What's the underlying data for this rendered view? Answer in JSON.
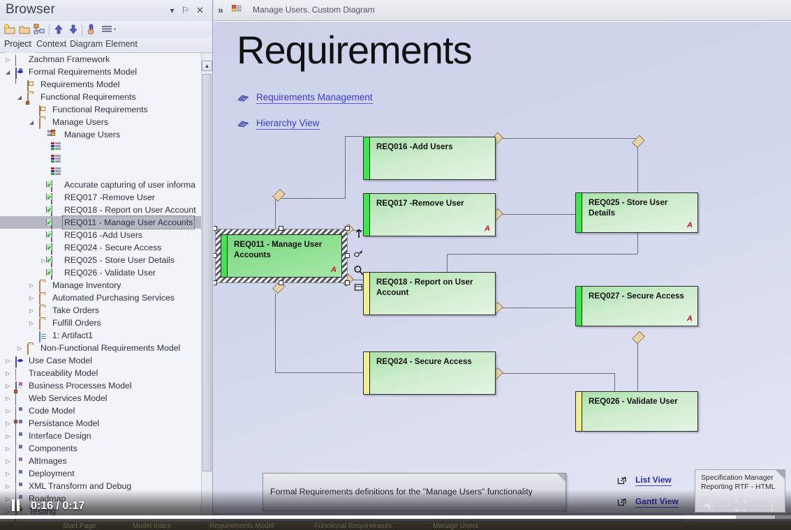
{
  "browser": {
    "title": "Browser",
    "header_buttons": [
      {
        "name": "caret-down-icon",
        "glyph": "▾"
      },
      {
        "name": "pin-icon",
        "glyph": "⚐"
      },
      {
        "name": "close-icon",
        "glyph": "✕"
      }
    ],
    "toolbar_icons": [
      "new-package-icon",
      "folder-icon",
      "hierarchy-icon",
      "move-up-icon",
      "move-down-icon",
      "pointer-hand-icon",
      "menu-icon"
    ],
    "tabs": [
      {
        "label": "Project",
        "active": true
      },
      {
        "label": "Context",
        "active": false
      },
      {
        "label": "Diagram",
        "active": false
      },
      {
        "label": "Element",
        "active": false
      }
    ],
    "tree": [
      {
        "label": "Zachman Framework",
        "indent": 0,
        "icon": "model-box",
        "arrow": "closed",
        "selected": false
      },
      {
        "label": "Formal Requirements Model",
        "indent": 0,
        "icon": "model-oval",
        "arrow": "open",
        "selected": false
      },
      {
        "label": "Requirements Model",
        "indent": 1,
        "icon": "package",
        "arrow": "none",
        "selected": false
      },
      {
        "label": "Functional Requirements",
        "indent": 1,
        "icon": "folder-sub",
        "arrow": "open",
        "selected": false
      },
      {
        "label": "Functional Requirements",
        "indent": 2,
        "icon": "package",
        "arrow": "none",
        "selected": false
      },
      {
        "label": "Manage Users",
        "indent": 2,
        "icon": "folder",
        "arrow": "open",
        "selected": false
      },
      {
        "label": "Manage Users",
        "indent": 3,
        "icon": "diagram",
        "arrow": "none",
        "selected": false
      },
      {
        "label": "",
        "indent": 3,
        "icon": "matrix",
        "arrow": "none",
        "selected": false
      },
      {
        "label": "",
        "indent": 3,
        "icon": "matrix",
        "arrow": "none",
        "selected": false
      },
      {
        "label": "",
        "indent": 3,
        "icon": "matrix",
        "arrow": "none",
        "selected": false
      },
      {
        "label": "Accurate capturing of user informa",
        "indent": 3,
        "icon": "requirement",
        "arrow": "none",
        "selected": false
      },
      {
        "label": "REQ017 -Remove User",
        "indent": 3,
        "icon": "requirement",
        "arrow": "none",
        "selected": false
      },
      {
        "label": "REQ018 - Report on User Account",
        "indent": 3,
        "icon": "requirement",
        "arrow": "none",
        "selected": false
      },
      {
        "label": "REQ011 - Manage User Accounts",
        "indent": 3,
        "icon": "requirement",
        "arrow": "none",
        "selected": true
      },
      {
        "label": "REQ016 -Add Users",
        "indent": 3,
        "icon": "requirement",
        "arrow": "none",
        "selected": false
      },
      {
        "label": "REQ024 - Secure Access",
        "indent": 3,
        "icon": "requirement",
        "arrow": "none",
        "selected": false
      },
      {
        "label": "REQ025 - Store User Details",
        "indent": 3,
        "icon": "requirement",
        "arrow": "closed",
        "selected": false
      },
      {
        "label": "REQ026 - Validate User",
        "indent": 3,
        "icon": "requirement",
        "arrow": "none",
        "selected": false
      },
      {
        "label": "Manage Inventory",
        "indent": 2,
        "icon": "folder",
        "arrow": "closed",
        "selected": false
      },
      {
        "label": "Automated Purchasing Services",
        "indent": 2,
        "icon": "folder",
        "arrow": "closed",
        "selected": false
      },
      {
        "label": "Take Orders",
        "indent": 2,
        "icon": "folder",
        "arrow": "closed",
        "selected": false
      },
      {
        "label": "Fulfill Orders",
        "indent": 2,
        "icon": "folder",
        "arrow": "closed",
        "selected": false
      },
      {
        "label": "1: Artifact1",
        "indent": 2,
        "icon": "artifact",
        "arrow": "none",
        "selected": false
      },
      {
        "label": "Non-Functional Requirements Model",
        "indent": 1,
        "icon": "folder",
        "arrow": "closed",
        "selected": false
      },
      {
        "label": "Use Case Model",
        "indent": 0,
        "icon": "model-oval",
        "arrow": "closed",
        "selected": false
      },
      {
        "label": "Traceability Model",
        "indent": 0,
        "icon": "model-pink",
        "arrow": "closed",
        "selected": false
      },
      {
        "label": "Business Processes Model",
        "indent": 0,
        "icon": "flow-sub",
        "arrow": "closed",
        "selected": false
      },
      {
        "label": "Web Services Model",
        "indent": 0,
        "icon": "model-sub",
        "arrow": "closed",
        "selected": false
      },
      {
        "label": "Code Model",
        "indent": 0,
        "icon": "model-box",
        "arrow": "closed",
        "selected": false
      },
      {
        "label": "Persistance Model",
        "indent": 0,
        "icon": "model-box",
        "arrow": "closed",
        "selected": false
      },
      {
        "label": "Interface Design",
        "indent": 0,
        "icon": "model-box",
        "arrow": "closed",
        "selected": false
      },
      {
        "label": "Components",
        "indent": 0,
        "icon": "model-lilac",
        "arrow": "closed",
        "selected": false
      },
      {
        "label": "AltImages",
        "indent": 0,
        "icon": "model-box",
        "arrow": "closed",
        "selected": false
      },
      {
        "label": "Deployment",
        "indent": 0,
        "icon": "model-box",
        "arrow": "closed",
        "selected": false
      },
      {
        "label": "XML Transform and Debug",
        "indent": 0,
        "icon": "model-lilac",
        "arrow": "closed",
        "selected": false
      },
      {
        "label": "Roadmap",
        "indent": 0,
        "icon": "model-box",
        "arrow": "closed",
        "selected": false
      },
      {
        "label": "Testing",
        "indent": 0,
        "icon": "folder",
        "arrow": "closed",
        "selected": false
      }
    ]
  },
  "diagram": {
    "tab_label": "Manage Users.  Custom Diagram",
    "chevron": "»",
    "title": "Requirements",
    "links": [
      {
        "label": "Requirements Management"
      },
      {
        "label": "Hierarchy View"
      }
    ],
    "elements": [
      {
        "id": "req016",
        "label": "REQ016 -Add Users",
        "bar": "green",
        "amark": ""
      },
      {
        "id": "req017",
        "label": "REQ017 -Remove User",
        "bar": "green",
        "amark": "A"
      },
      {
        "id": "req018",
        "label": "REQ018 - Report on User Account",
        "bar": "yellow",
        "amark": ""
      },
      {
        "id": "req024",
        "label": "REQ024 - Secure Access",
        "bar": "yellow",
        "amark": ""
      },
      {
        "id": "req025",
        "label": "REQ025 - Store User Details",
        "bar": "green",
        "amark": "A"
      },
      {
        "id": "req027",
        "label": "REQ027 - Secure Access",
        "bar": "green",
        "amark": "A"
      },
      {
        "id": "req026",
        "label": "REQ026 - Validate User",
        "bar": "yellow",
        "amark": ""
      },
      {
        "id": "req011",
        "label": "REQ011 - Manage User Accounts",
        "bar": "green",
        "amark": "A",
        "selected": true
      }
    ],
    "quicklinks": [
      {
        "name": "quicklink-arrow-icon"
      },
      {
        "name": "quicklink-pin-icon"
      },
      {
        "name": "quicklink-search-icon"
      },
      {
        "name": "quicklink-note-icon"
      }
    ],
    "note": "Formal Requirements definitions for the \"Manage Users\" functionality",
    "view_links": [
      {
        "label": "List View"
      },
      {
        "label": "Gantt View"
      }
    ]
  },
  "video": {
    "note_line1": "Specification Manager",
    "note_line2": "Reporting RTF - HTML",
    "current_time": "0:16",
    "total_time": "0:17",
    "time_display": "0:16 / 0:17",
    "played_percent": 93,
    "buffered_percent": 98,
    "controls": [
      {
        "name": "volume-icon"
      },
      {
        "name": "fullscreen-icon"
      },
      {
        "name": "more-options-icon"
      }
    ],
    "play_state": "paused"
  },
  "status_bar": {
    "tabs": [
      {
        "label": "Start Page"
      },
      {
        "label": "Model Index"
      },
      {
        "label": "Requirements Model"
      },
      {
        "label": "Functional Requirements"
      },
      {
        "label": "Manage Users"
      }
    ]
  }
}
